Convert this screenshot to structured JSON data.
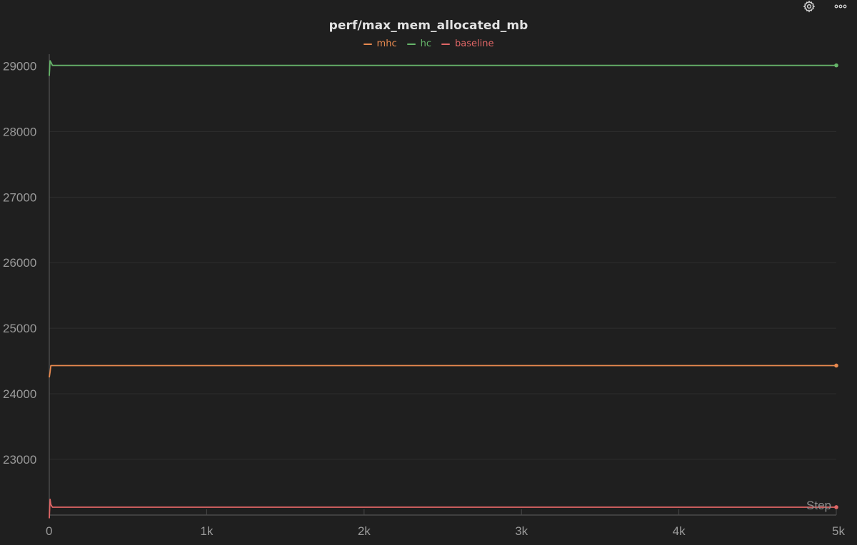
{
  "toolbar": {
    "icons": [
      "gear-icon",
      "more-horizontal-icon"
    ]
  },
  "chart_data": {
    "type": "line",
    "title": "perf/max_mem_allocated_mb",
    "xlabel": "Step",
    "ylabel": "",
    "xlim": [
      0,
      5000
    ],
    "ylim": [
      22150,
      29180
    ],
    "x_ticks": [
      0,
      1000,
      2000,
      3000,
      4000,
      5000
    ],
    "x_tick_labels": [
      "0",
      "1k",
      "2k",
      "3k",
      "4k",
      "5k"
    ],
    "y_ticks": [
      23000,
      24000,
      25000,
      26000,
      27000,
      28000,
      29000
    ],
    "y_tick_labels": [
      "23000",
      "24000",
      "25000",
      "26000",
      "27000",
      "28000",
      "29000"
    ],
    "grid": true,
    "legend_position": "top-center",
    "series": [
      {
        "name": "mhc",
        "color": "#e8894f",
        "points": [
          [
            0,
            24250
          ],
          [
            5,
            24330
          ],
          [
            10,
            24430
          ],
          [
            5000,
            24430
          ]
        ]
      },
      {
        "name": "hc",
        "color": "#66b66a",
        "points": [
          [
            0,
            28850
          ],
          [
            5,
            29080
          ],
          [
            10,
            29060
          ],
          [
            20,
            29010
          ],
          [
            5000,
            29010
          ]
        ]
      },
      {
        "name": "baseline",
        "color": "#e06666",
        "points": [
          [
            0,
            22100
          ],
          [
            5,
            22390
          ],
          [
            10,
            22310
          ],
          [
            20,
            22270
          ],
          [
            5000,
            22270
          ]
        ]
      }
    ]
  }
}
